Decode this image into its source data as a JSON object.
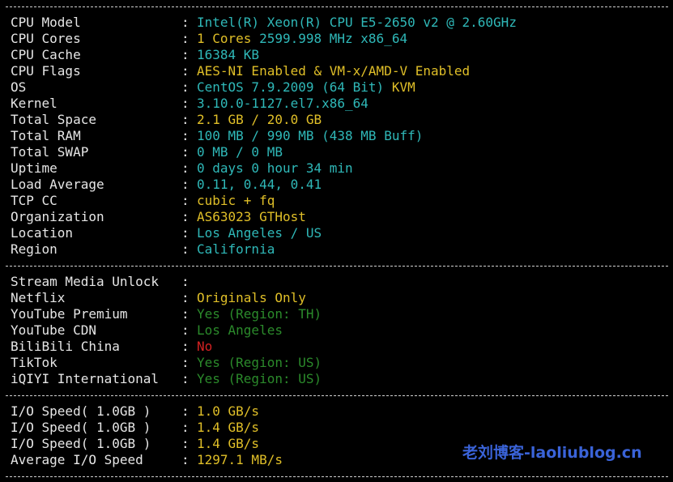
{
  "separator_char": "-",
  "system": [
    {
      "label": "CPU Model",
      "value": "Intel(R) Xeon(R) CPU E5-2650 v2 @ 2.60GHz",
      "color": "cyan"
    },
    {
      "label": "CPU Cores",
      "value_parts": [
        {
          "text": "1 Cores ",
          "color": "yellow"
        },
        {
          "text": "2599.998 MHz x86_64",
          "color": "cyan"
        }
      ]
    },
    {
      "label": "CPU Cache",
      "value": "16384 KB",
      "color": "cyan"
    },
    {
      "label": "CPU Flags",
      "value": "AES-NI Enabled & VM-x/AMD-V Enabled",
      "color": "yellow"
    },
    {
      "label": "OS",
      "value_parts": [
        {
          "text": "CentOS 7.9.2009 (64 Bit) ",
          "color": "cyan"
        },
        {
          "text": "KVM",
          "color": "yellow"
        }
      ]
    },
    {
      "label": "Kernel",
      "value": "3.10.0-1127.el7.x86_64",
      "color": "cyan"
    },
    {
      "label": "Total Space",
      "value": "2.1 GB / 20.0 GB",
      "color": "yellow"
    },
    {
      "label": "Total RAM",
      "value": "100 MB / 990 MB (438 MB Buff)",
      "color": "cyan"
    },
    {
      "label": "Total SWAP",
      "value": "0 MB / 0 MB",
      "color": "cyan"
    },
    {
      "label": "Uptime",
      "value": "0 days 0 hour 34 min",
      "color": "cyan"
    },
    {
      "label": "Load Average",
      "value": "0.11, 0.44, 0.41",
      "color": "cyan"
    },
    {
      "label": "TCP CC",
      "value": "cubic + fq",
      "color": "yellow"
    },
    {
      "label": "Organization",
      "value": "AS63023 GTHost",
      "color": "yellow"
    },
    {
      "label": "Location",
      "value": "Los Angeles / US",
      "color": "cyan"
    },
    {
      "label": "Region",
      "value": "California",
      "color": "cyan"
    }
  ],
  "media": [
    {
      "label": "Stream Media Unlock",
      "value": "",
      "color": "white"
    },
    {
      "label": "Netflix",
      "value": "Originals Only",
      "color": "yellow"
    },
    {
      "label": "YouTube Premium",
      "value": "Yes (Region: TH)",
      "color": "green"
    },
    {
      "label": "YouTube CDN",
      "value": "Los Angeles",
      "color": "green"
    },
    {
      "label": "BiliBili China",
      "value": "No",
      "color": "red"
    },
    {
      "label": "TikTok",
      "value": "Yes (Region: US)",
      "color": "green"
    },
    {
      "label": "iQIYI International",
      "value": "Yes (Region: US)",
      "color": "green"
    }
  ],
  "io": [
    {
      "label": "I/O Speed( 1.0GB )",
      "value": "1.0 GB/s",
      "color": "yellow"
    },
    {
      "label": "I/O Speed( 1.0GB )",
      "value": "1.4 GB/s",
      "color": "yellow"
    },
    {
      "label": "I/O Speed( 1.0GB )",
      "value": "1.4 GB/s",
      "color": "yellow"
    },
    {
      "label": "Average I/O Speed",
      "value": "1297.1 MB/s",
      "color": "yellow"
    }
  ],
  "colon": ":",
  "watermark": "老刘博客-laoliublog.cn",
  "colors": {
    "background": "#000000",
    "label": "#e6e6e6",
    "cyan": "#2fb8b8",
    "yellow": "#e0bf28",
    "green": "#2b8a2b",
    "red": "#d42222",
    "watermark": "#3a63d8"
  }
}
